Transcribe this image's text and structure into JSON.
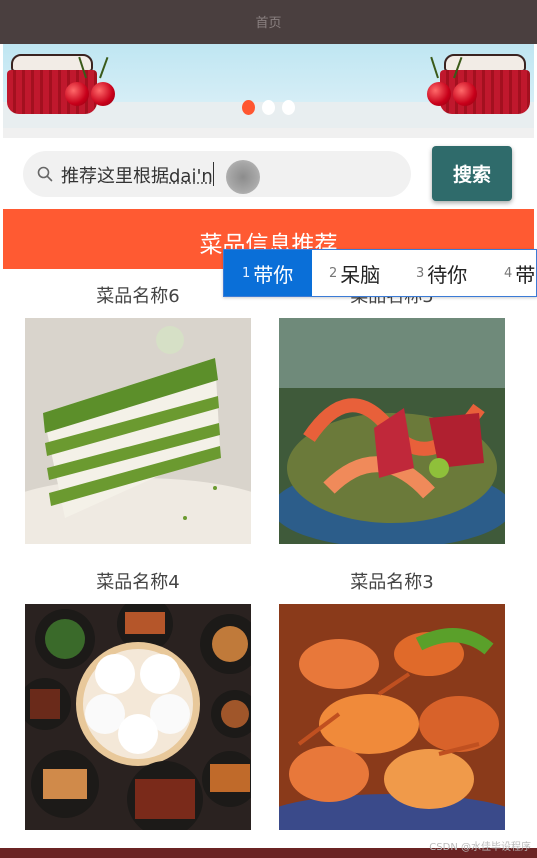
{
  "header": {
    "title": "首页"
  },
  "banner": {
    "slide_count": 3,
    "active_slide": 1
  },
  "search": {
    "typed_prefix": "推荐这里根据",
    "composing": "dai'n",
    "button_label": "搜索"
  },
  "section": {
    "title": "菜品信息推荐"
  },
  "ime": {
    "candidates": [
      {
        "index": "1",
        "text": "带你"
      },
      {
        "index": "2",
        "text": "呆脑"
      },
      {
        "index": "3",
        "text": "待你"
      },
      {
        "index": "4",
        "text": "带介"
      }
    ]
  },
  "dishes": [
    {
      "name": "菜品名称6",
      "image": "matcha-cake-slice"
    },
    {
      "name": "菜品名称5",
      "image": "sashimi-platter"
    },
    {
      "name": "菜品名称4",
      "image": "steamed-buns-banquet"
    },
    {
      "name": "菜品名称3",
      "image": "crayfish-bowl"
    }
  ],
  "footer": {
    "watermark": "CSDN @水佳毕设程序"
  },
  "colors": {
    "header_bg": "#4a3f3f",
    "accent": "#ff5a32",
    "search_button": "#2f6b6b",
    "ime_selected": "#0a6fd8"
  }
}
